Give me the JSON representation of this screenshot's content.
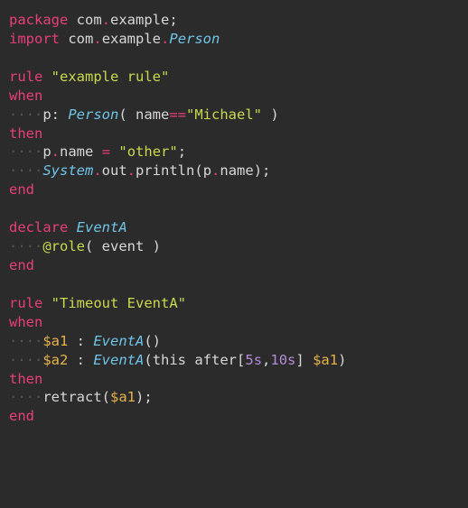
{
  "code": {
    "l1": {
      "kw": "package",
      "pkg_a": "com",
      "pkg_b": "example"
    },
    "l2": {
      "kw": "import",
      "pkg_a": "com",
      "pkg_b": "example",
      "cls": "Person"
    },
    "l4": {
      "kw": "rule",
      "name": "\"example rule\""
    },
    "l5": {
      "kw": "when"
    },
    "l6": {
      "var": "p",
      "cls": "Person",
      "field": "name",
      "op": "==",
      "val": "\"Michael\""
    },
    "l7": {
      "kw": "then"
    },
    "l8": {
      "obj": "p",
      "field": "name",
      "eq": "=",
      "val": "\"other\""
    },
    "l9": {
      "sys": "System",
      "out": "out",
      "println": "println",
      "obj": "p",
      "field": "name"
    },
    "l10": {
      "kw": "end"
    },
    "l12": {
      "kw": "declare",
      "cls": "EventA"
    },
    "l13": {
      "ann": "@role",
      "arg": "event"
    },
    "l14": {
      "kw": "end"
    },
    "l16": {
      "kw": "rule",
      "name": "\"Timeout EventA\""
    },
    "l17": {
      "kw": "when"
    },
    "l18": {
      "var": "$a1",
      "cls": "EventA"
    },
    "l19": {
      "var": "$a2",
      "cls": "EventA",
      "this": "this",
      "after": "after",
      "b1": "5s",
      "b2": "10s",
      "ref": "$a1"
    },
    "l20": {
      "kw": "then"
    },
    "l21": {
      "fn": "retract",
      "arg": "$a1"
    },
    "l22": {
      "kw": "end"
    }
  },
  "indent": "····"
}
